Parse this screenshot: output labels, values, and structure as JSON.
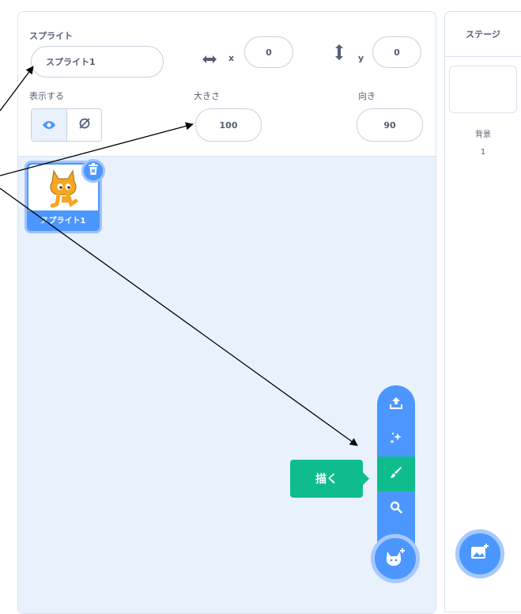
{
  "sprite_info": {
    "sprite_label": "スプライト",
    "sprite_name": "スプライト1",
    "x_label": "x",
    "x_value": "0",
    "y_label": "y",
    "y_value": "0",
    "show_label": "表示する",
    "size_label": "大きさ",
    "size_value": "100",
    "direction_label": "向き",
    "direction_value": "90"
  },
  "sprite_list": {
    "items": [
      {
        "name": "スプライト1"
      }
    ]
  },
  "sprite_menu": {
    "paint_tooltip": "描く",
    "items": [
      "upload-icon",
      "surprise-icon",
      "paint-icon",
      "search-icon"
    ]
  },
  "stage": {
    "title": "ステージ",
    "backdrops_label": "背景",
    "backdrops_count": "1"
  },
  "colors": {
    "accent": "#4c97ff",
    "paint": "#0fbd8c",
    "pane_bg": "#e9f1fc",
    "text": "#575e75"
  }
}
